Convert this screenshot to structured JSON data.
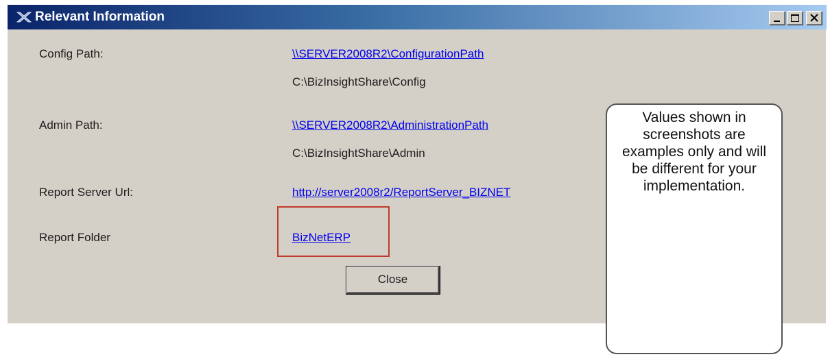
{
  "window": {
    "title": "Relevant Information",
    "controls": {
      "minimize_icon": "minimize-icon",
      "maximize_icon": "maximize-icon",
      "close_icon": "close-icon"
    }
  },
  "fields": [
    {
      "label": "Config Path:",
      "link": "\\\\SERVER2008R2\\ConfigurationPath",
      "value": "C:\\BizInsightShare\\Config"
    },
    {
      "label": "Admin Path:",
      "link": "\\\\SERVER2008R2\\AdministrationPath",
      "value": "C:\\BizInsightShare\\Admin"
    },
    {
      "label": "Report Server Url:",
      "link": "http://server2008r2/ReportServer_BIZNET"
    },
    {
      "label": "Report Folder",
      "link": "BizNetERP"
    }
  ],
  "callout": {
    "text": "Values shown in screenshots are examples only and will be different for your implementation."
  },
  "buttons": {
    "close_label": "Close"
  },
  "colors": {
    "title_gradient_start": "#0a246a",
    "title_gradient_end": "#a6caf0",
    "link": "#0000ee",
    "highlight": "#c0392b",
    "window_bg": "#d4d0c8"
  }
}
